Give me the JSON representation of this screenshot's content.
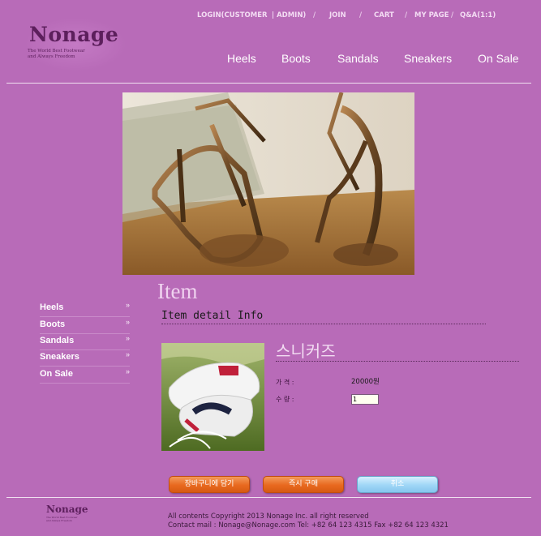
{
  "header": {
    "top_links": {
      "login": "LOGIN(CUSTOMER",
      "admin": "| ADMIN)",
      "join": "JOIN",
      "cart": "CART",
      "mypage": "MY PAGE",
      "qna": "Q&A(1:1)",
      "separator": "/"
    },
    "logo": {
      "title": "Nonage",
      "tagline_1": "The World Best Footwear",
      "tagline_2": "and Always Freedom"
    },
    "main_nav": [
      "Heels",
      "Boots",
      "Sandals",
      "Sneakers",
      "On Sale"
    ]
  },
  "sidebar": {
    "items": [
      {
        "label": "Heels"
      },
      {
        "label": "Boots"
      },
      {
        "label": "Sandals"
      },
      {
        "label": "Sneakers"
      },
      {
        "label": "On Sale"
      }
    ],
    "chevron": "»"
  },
  "content": {
    "heading": "Item",
    "subheading": "Item detail Info",
    "product": {
      "name": "스니커즈",
      "price_label": "가 격 :",
      "price_value": "20000원",
      "qty_label": "수 량 :",
      "qty_value": "1"
    },
    "buttons": {
      "add_to_cart": "장바구니에 담기",
      "buy_now": "즉시 구매",
      "cancel": "취소"
    }
  },
  "footer": {
    "logo_title": "Nonage",
    "logo_tagline_1": "The World Best Footwear",
    "logo_tagline_2": "and Always Freedom",
    "copyright": "All contents Copyright 2013 Nonage Inc. all right reserved",
    "contact": "Contact mail : Nonage@Nonage.com Tel: +82 64 123 4315 Fax +82 64 123 4321"
  },
  "colors": {
    "background": "#b86bb8",
    "logo": "#5c1f5c",
    "button_orange": "#e8691f",
    "button_blue": "#9fd6f6"
  }
}
